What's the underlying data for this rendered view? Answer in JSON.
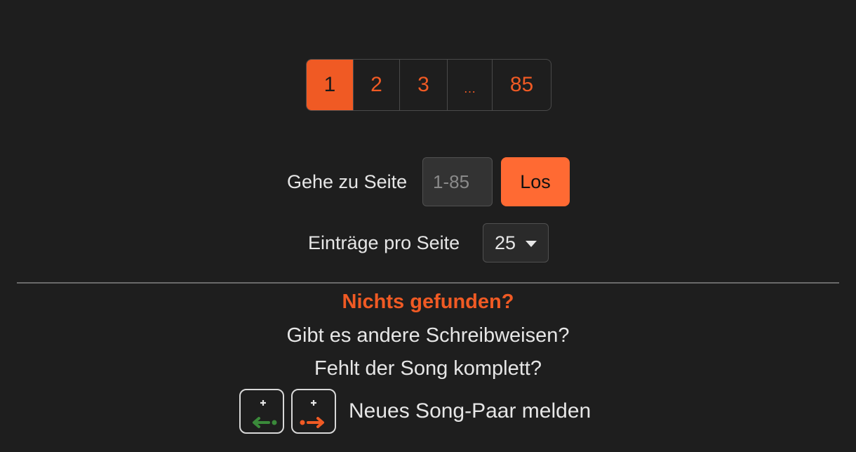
{
  "pagination": {
    "pages": [
      "1",
      "2",
      "3",
      "…",
      "85"
    ],
    "active": "1"
  },
  "goto": {
    "label": "Gehe zu Seite",
    "placeholder": "1-85",
    "button": "Los"
  },
  "per_page": {
    "label": "Einträge pro Seite",
    "selected": "25"
  },
  "notfound": {
    "title": "Nichts gefunden?",
    "alt_spellings": "Gibt es andere Schreibweisen?",
    "missing_song": "Fehlt der Song komplett?",
    "report": "Neues Song-Paar melden"
  },
  "icons": {
    "left": "add-pair-left-icon",
    "right": "add-pair-right-icon"
  },
  "colors": {
    "accent": "#f05a24",
    "button": "#ff6a33",
    "green": "#3a8a3a",
    "background": "#1e1e1e"
  }
}
